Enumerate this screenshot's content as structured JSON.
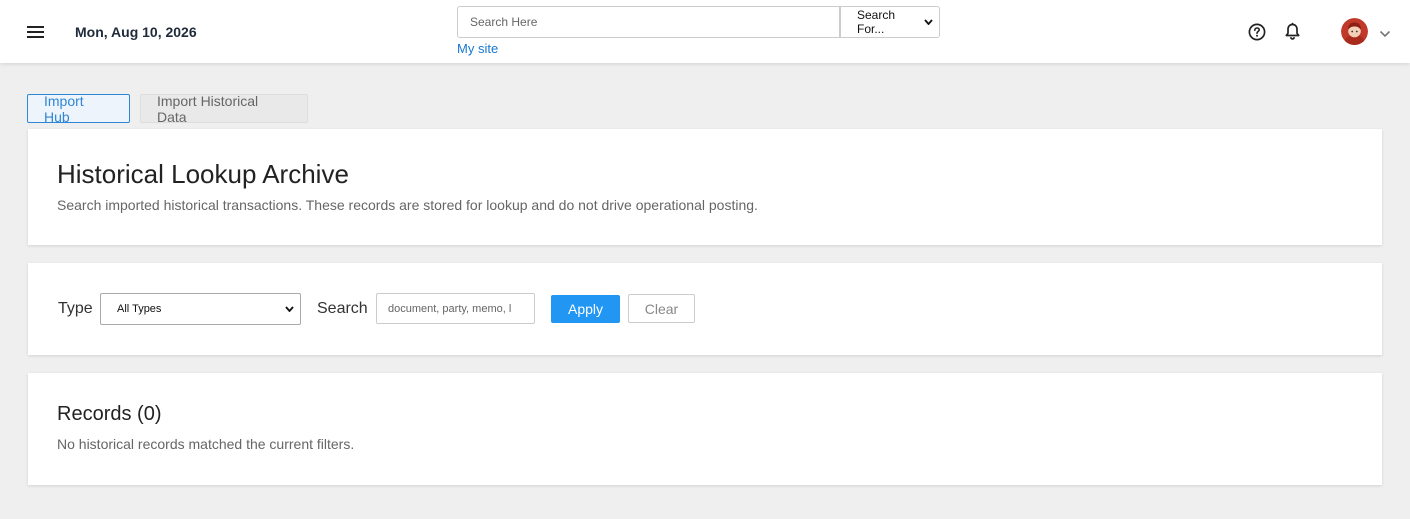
{
  "header": {
    "date": "Mon, Aug 10, 2026",
    "search_placeholder": "Search Here",
    "search_scope": "Search For...",
    "my_site": "My site"
  },
  "tabs": [
    {
      "label": "Import Hub",
      "active": true
    },
    {
      "label": "Import Historical Data",
      "active": false
    }
  ],
  "page": {
    "title": "Historical Lookup Archive",
    "description": "Search imported historical transactions. These records are stored for lookup and do not drive operational posting."
  },
  "filters": {
    "type_label": "Type",
    "type_value": "All Types",
    "search_label": "Search",
    "search_placeholder": "document, party, memo, l",
    "apply": "Apply",
    "clear": "Clear"
  },
  "records": {
    "title": "Records (0)",
    "empty_message": "No historical records matched the current filters."
  },
  "colors": {
    "accent": "#2196f3",
    "link": "#1677d2",
    "background": "#efefef"
  },
  "icons": [
    "menu-icon",
    "help-icon",
    "bell-icon",
    "chevron-down-icon"
  ]
}
